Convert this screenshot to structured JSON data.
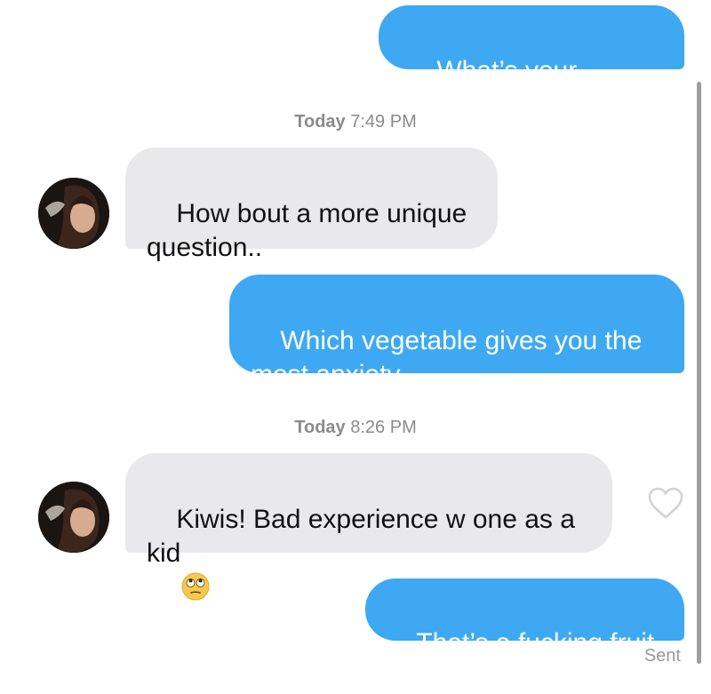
{
  "messages": [
    {
      "id": "m1",
      "direction": "outgoing",
      "text": "What’s your major?"
    },
    {
      "id": "m2",
      "direction": "incoming",
      "text": "How bout a more unique\nquestion.."
    },
    {
      "id": "m3",
      "direction": "outgoing",
      "text": "Which vegetable gives you the\nmost anxiety"
    },
    {
      "id": "m4",
      "direction": "incoming",
      "text": "Kiwis! Bad experience w one as a\nkid"
    },
    {
      "id": "m5",
      "direction": "outgoing",
      "text": "That’s a fucking fruit"
    }
  ],
  "timestamps": [
    {
      "day": "Today",
      "time": "7:49 PM"
    },
    {
      "day": "Today",
      "time": "8:26 PM"
    }
  ],
  "status": {
    "sent_label": "Sent"
  },
  "icons": {
    "like": "heart-outline-icon",
    "emoji": "eye-roll-emoji-icon"
  },
  "colors": {
    "outgoing_bubble": "#3ea9f2",
    "incoming_bubble": "#e9e9eb",
    "timestamp_text": "#8b8b8b"
  }
}
